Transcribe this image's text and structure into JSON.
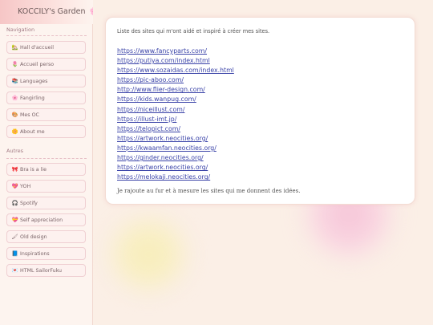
{
  "site": {
    "title": "KOCCILY's Garden",
    "title_icon": "🌸"
  },
  "sidebar": {
    "navigation_heading": "Navigation",
    "navigation": [
      {
        "icon": "🏡",
        "label": "Hall d'accueil"
      },
      {
        "icon": "🌷",
        "label": "Accueil perso"
      },
      {
        "icon": "📚",
        "label": "Languages"
      },
      {
        "icon": "🌸",
        "label": "Fangirling"
      },
      {
        "icon": "🎨",
        "label": "Mes OC"
      },
      {
        "icon": "🌼",
        "label": "About me"
      }
    ],
    "others_heading": "Autres",
    "others": [
      {
        "icon": "🎀",
        "label": "Bra is a lie"
      },
      {
        "icon": "💖",
        "label": "YOH"
      },
      {
        "icon": "🎧",
        "label": "Spotify"
      },
      {
        "icon": "💝",
        "label": "Self appreciation"
      },
      {
        "icon": "🖌",
        "label": "Old design"
      },
      {
        "icon": "📘",
        "label": "Inspirations"
      },
      {
        "icon": "💌",
        "label": "HTML SailorFuku"
      }
    ]
  },
  "main": {
    "intro": "Liste des sites qui m'ont aidé et inspiré à créer mes sites.",
    "links": [
      "https://www.fancyparts.com/",
      "https://putiya.com/index.html",
      "https://www.sozaidas.com/index.html",
      "https://pic-aboo.com/",
      "http://www.flier-design.com/",
      "https://kids.wanpug.com/",
      "https://niceillust.com/",
      "https://illust-imt.jp/",
      "https://telopict.com/",
      "https://artwork.neocities.org/",
      "https://kwaamfan.neocities.org/",
      "https://ginder.neocities.org/",
      "https://artwork.neocities.org/",
      "https://melokaji.neocities.org/"
    ],
    "outro": "Je rajoute au fur et à mesure les sites qui me donnent des idées."
  },
  "colors": {
    "link": "#3a43a8",
    "accent_pink": "#f6c3d6",
    "background": "#fbefe6"
  }
}
